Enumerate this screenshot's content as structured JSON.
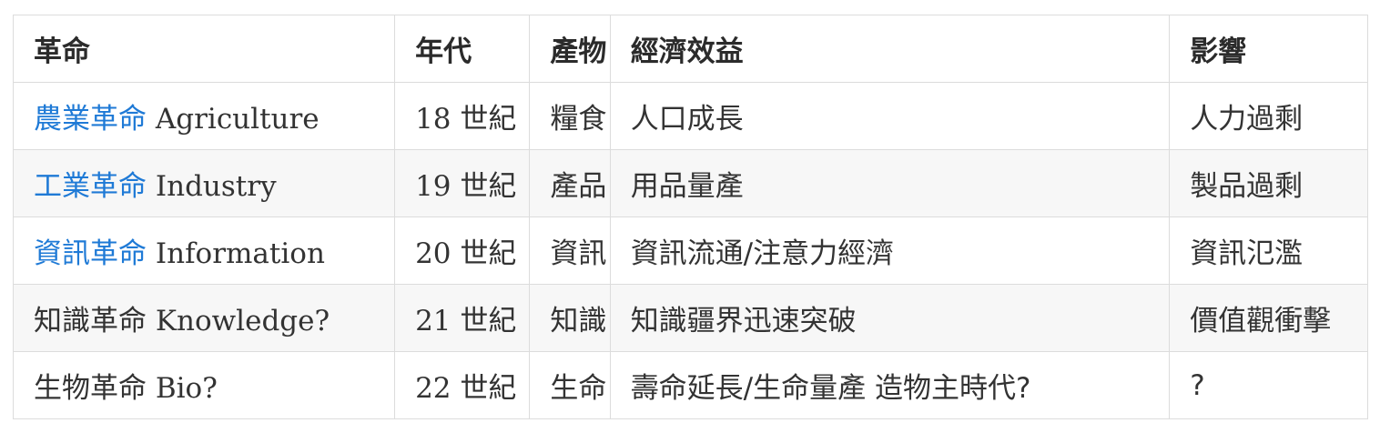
{
  "table": {
    "headers": [
      "革命",
      "年代",
      "產物",
      "經濟效益",
      "影響"
    ],
    "rows": [
      {
        "rev_cjk": "農業革命",
        "rev_latin": "Agriculture",
        "linked": true,
        "era": "18 世紀",
        "product": "糧食",
        "econ": "人口成長",
        "impact": "人力過剩"
      },
      {
        "rev_cjk": "工業革命",
        "rev_latin": "Industry",
        "linked": true,
        "era": "19 世紀",
        "product": "產品",
        "econ": "用品量產",
        "impact": "製品過剩"
      },
      {
        "rev_cjk": "資訊革命",
        "rev_latin": "Information",
        "linked": true,
        "era": "20 世紀",
        "product": "資訊",
        "econ": "資訊流通/注意力經濟",
        "impact": "資訊氾濫"
      },
      {
        "rev_cjk": "知識革命",
        "rev_latin": "Knowledge?",
        "linked": false,
        "era": "21 世紀",
        "product": "知識",
        "econ": "知識疆界迅速突破",
        "impact": "價值觀衝擊"
      },
      {
        "rev_cjk": "生物革命",
        "rev_latin": "Bio?",
        "linked": false,
        "era": "22 世紀",
        "product": "生命",
        "econ": "壽命延長/生命量產 造物主時代?",
        "impact": "?"
      }
    ]
  },
  "colors": {
    "link": "#1f7ad6",
    "text": "#333333",
    "border": "#dcdcdc",
    "stripe": "#f7f7f7"
  }
}
